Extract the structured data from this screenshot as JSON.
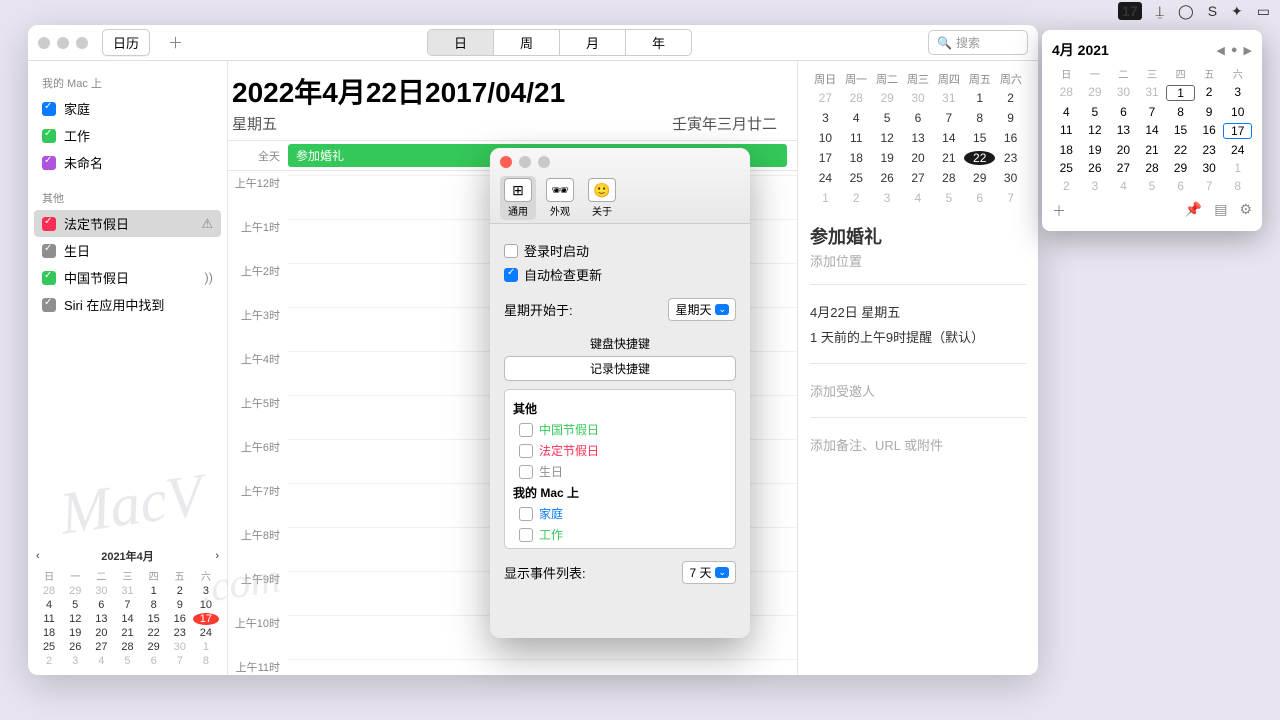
{
  "menubar": {
    "badge": "17"
  },
  "window": {
    "segLabel": "日历",
    "views": [
      "日",
      "周",
      "月",
      "年"
    ],
    "activeView": 0,
    "searchPlaceholder": "搜索"
  },
  "sidebar": {
    "section1": "我的 Mac 上",
    "items1": [
      {
        "label": "家庭",
        "color": "#0a7aff"
      },
      {
        "label": "工作",
        "color": "#34c759"
      },
      {
        "label": "未命名",
        "color": "#af52de"
      }
    ],
    "section2": "其他",
    "items2": [
      {
        "label": "法定节假日",
        "color": "#ff2d55",
        "selected": true,
        "warn": true
      },
      {
        "label": "生日",
        "color": "#8e8e93"
      },
      {
        "label": "中国节假日",
        "color": "#34c759",
        "rss": true
      },
      {
        "label": "Siri 在应用中找到",
        "color": "#8e8e93"
      }
    ]
  },
  "miniCal": {
    "title": "2021年4月",
    "weeknames": [
      "日",
      "一",
      "二",
      "三",
      "四",
      "五",
      "六"
    ],
    "rows": [
      [
        "28",
        "29",
        "30",
        "31",
        "1",
        "2",
        "3"
      ],
      [
        "4",
        "5",
        "6",
        "7",
        "8",
        "9",
        "10"
      ],
      [
        "11",
        "12",
        "13",
        "14",
        "15",
        "16",
        "17"
      ],
      [
        "18",
        "19",
        "20",
        "21",
        "22",
        "23",
        "24"
      ],
      [
        "25",
        "26",
        "27",
        "28",
        "29",
        "30",
        "1"
      ],
      [
        "2",
        "3",
        "4",
        "5",
        "6",
        "7",
        "8"
      ]
    ],
    "dimFirst": 4,
    "dimLastFrom": 33,
    "today": "17"
  },
  "day": {
    "title": "2022年4月22日2017/04/21",
    "weekday": "星期五",
    "lunar": "壬寅年三月廿二",
    "alldayLabel": "全天",
    "event": "参加婚礼",
    "hours": [
      "上午12时",
      "上午1时",
      "上午2时",
      "上午3时",
      "上午4时",
      "上午5时",
      "上午6时",
      "上午7时",
      "上午8时",
      "上午9时",
      "上午10时",
      "上午11时"
    ]
  },
  "monthNav": {
    "weeknames": [
      "周日",
      "周一",
      "周二",
      "周三",
      "周四",
      "周五",
      "周六"
    ],
    "rows": [
      [
        "27",
        "28",
        "29",
        "30",
        "31",
        "1",
        "2"
      ],
      [
        "3",
        "4",
        "5",
        "6",
        "7",
        "8",
        "9"
      ],
      [
        "10",
        "11",
        "12",
        "13",
        "14",
        "15",
        "16"
      ],
      [
        "17",
        "18",
        "19",
        "20",
        "21",
        "22",
        "23"
      ],
      [
        "24",
        "25",
        "26",
        "27",
        "28",
        "29",
        "30"
      ],
      [
        "1",
        "2",
        "3",
        "4",
        "5",
        "6",
        "7"
      ]
    ],
    "selected": "22"
  },
  "eventDetail": {
    "title": "参加婚礼",
    "location": "添加位置",
    "date": "4月22日 星期五",
    "alert": "1 天前的上午9时提醒（默认）",
    "invitees": "添加受邀人",
    "notes": "添加备注、URL 或附件"
  },
  "prefs": {
    "tabs": [
      {
        "l": "通用"
      },
      {
        "l": "外观"
      },
      {
        "l": "关于"
      }
    ],
    "launch": "登录时启动",
    "update": "自动检查更新",
    "weekStart": "星期开始于:",
    "weekStartVal": "星期天",
    "kbTitle": "键盘快捷键",
    "kbBtn": "记录快捷键",
    "grp1": "其他",
    "g1items": [
      {
        "l": "中国节假日",
        "c": "#34c759"
      },
      {
        "l": "法定节假日",
        "c": "#ff2d55"
      },
      {
        "l": "生日",
        "c": "#8e8e93"
      }
    ],
    "grp2": "我的 Mac 上",
    "g2items": [
      {
        "l": "家庭",
        "c": "#0a7aff"
      },
      {
        "l": "工作",
        "c": "#34c759"
      }
    ],
    "listLabel": "显示事件列表:",
    "listVal": "7 天"
  },
  "popover": {
    "title": "4月 2021",
    "weeknames": [
      "日",
      "一",
      "二",
      "三",
      "四",
      "五",
      "六"
    ],
    "rows": [
      [
        "28",
        "29",
        "30",
        "31",
        "1",
        "2",
        "3"
      ],
      [
        "4",
        "5",
        "6",
        "7",
        "8",
        "9",
        "10"
      ],
      [
        "11",
        "12",
        "13",
        "14",
        "15",
        "16",
        "17"
      ],
      [
        "18",
        "19",
        "20",
        "21",
        "22",
        "23",
        "24"
      ],
      [
        "25",
        "26",
        "27",
        "28",
        "29",
        "30",
        "1"
      ],
      [
        "2",
        "3",
        "4",
        "5",
        "6",
        "7",
        "8"
      ]
    ],
    "today": "17"
  }
}
